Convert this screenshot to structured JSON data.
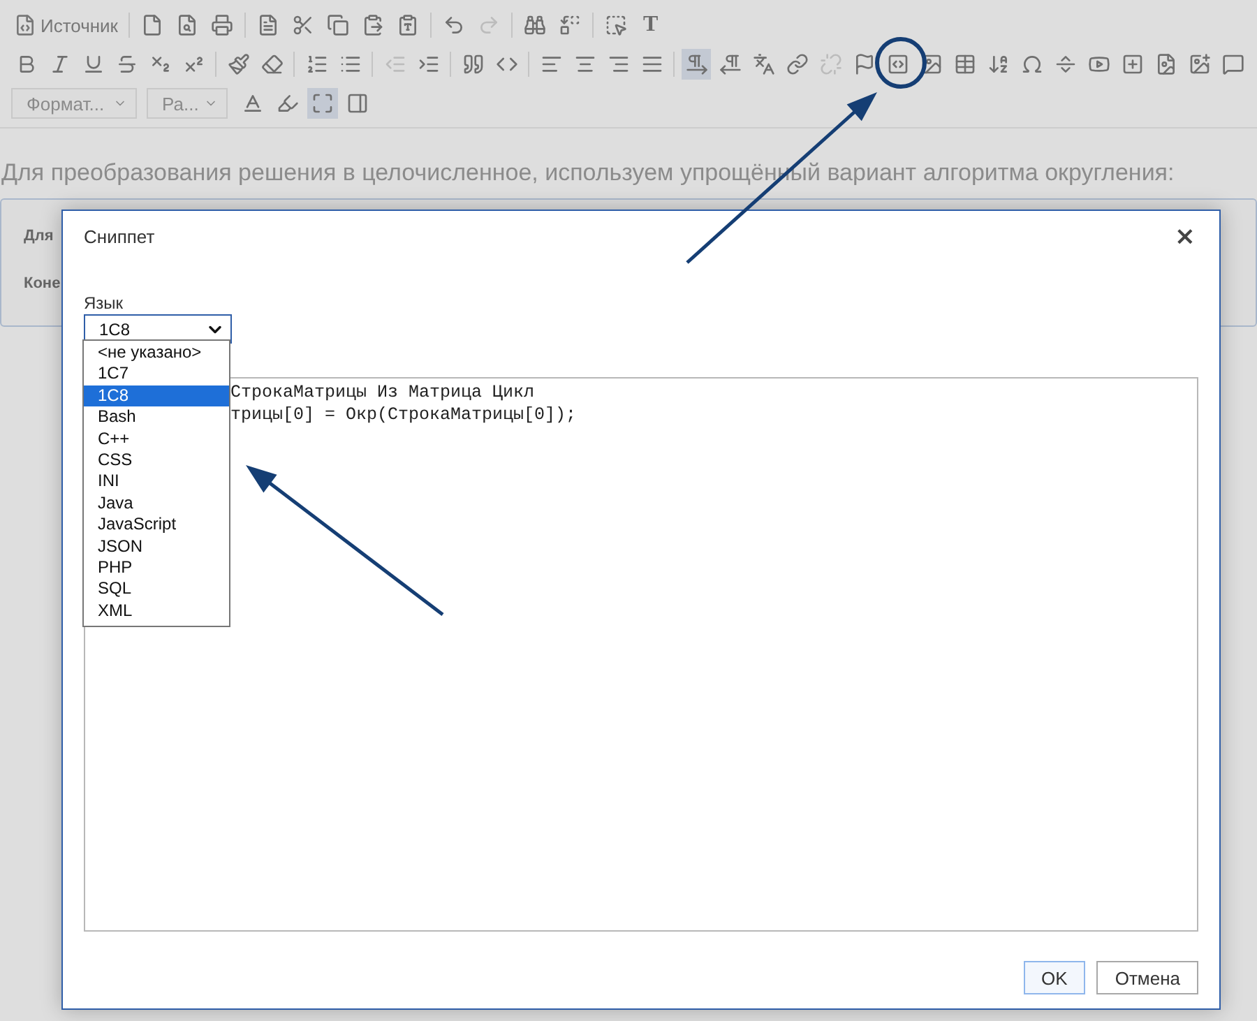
{
  "toolbar": {
    "source_button": "Источник",
    "text_style_button": "T",
    "format_combo": "Формат...",
    "style_combo": "Ра...",
    "redo": {
      "disabled": true
    },
    "outdent": {
      "disabled": true
    },
    "unlink": {
      "disabled": true
    },
    "ltr": {
      "selected": true
    },
    "rtl": {
      "selected": false
    },
    "maximize": {
      "selected": true
    }
  },
  "editor": {
    "paragraph": "Для преобразования решения в целочисленное, используем упрощённый вариант алгоритма округления:",
    "card_labels": [
      "Для",
      "Коне"
    ]
  },
  "dialog": {
    "title": "Сниппет",
    "close": "×",
    "language_label": "Язык",
    "language_value": "1C8",
    "options": [
      {
        "label": "<не указано>",
        "selected": false
      },
      {
        "label": "1C7",
        "selected": false
      },
      {
        "label": "1C8",
        "selected": true
      },
      {
        "label": "Bash",
        "selected": false
      },
      {
        "label": "C++",
        "selected": false
      },
      {
        "label": "CSS",
        "selected": false
      },
      {
        "label": "INI",
        "selected": false
      },
      {
        "label": "Java",
        "selected": false
      },
      {
        "label": "JavaScript",
        "selected": false
      },
      {
        "label": "JSON",
        "selected": false
      },
      {
        "label": "PHP",
        "selected": false
      },
      {
        "label": "SQL",
        "selected": false
      },
      {
        "label": "XML",
        "selected": false
      }
    ],
    "code_lines": [
      "СтрокаМатрицы Из Матрица Цикл",
      "трицы[0] = Окр(СтрокаМатрицы[0]);"
    ],
    "buttons": [
      {
        "label": "OK",
        "focused": true
      },
      {
        "label": "Отмена",
        "focused": false
      }
    ]
  }
}
